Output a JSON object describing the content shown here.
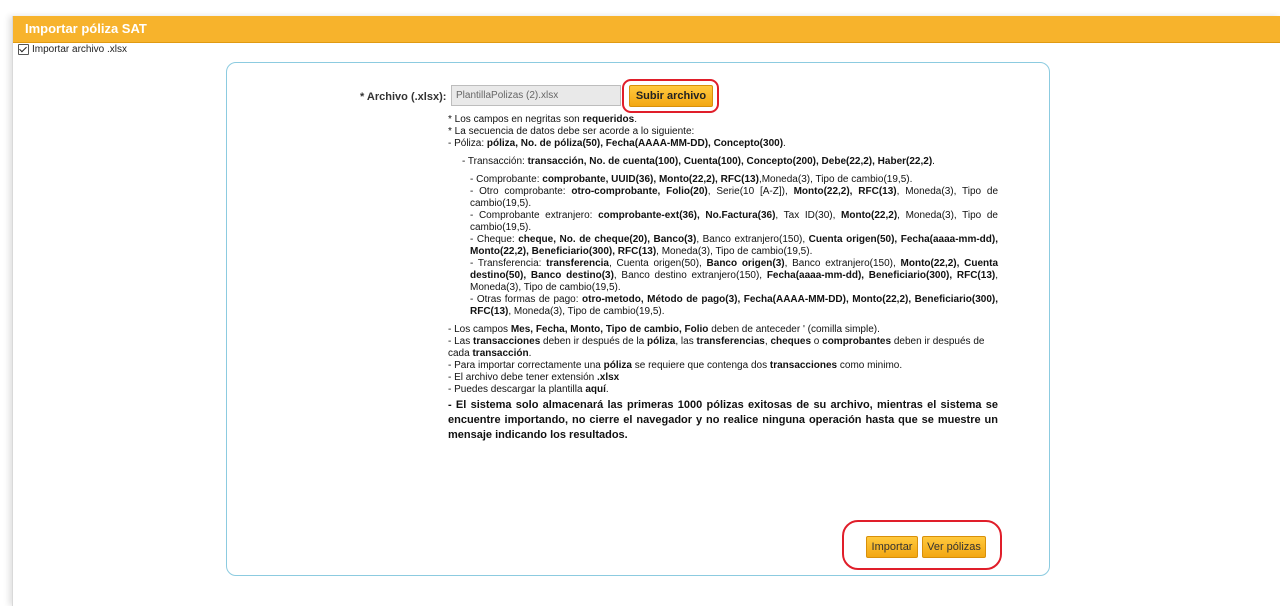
{
  "window": {
    "title": "Importar póliza SAT"
  },
  "import_toggle": {
    "label": "Importar archivo .xlsx",
    "checked": true
  },
  "file_field": {
    "label": "* Archivo (.xlsx):",
    "value": "PlantillaPolizas (2).xlsx",
    "upload_button": "Subir archivo"
  },
  "instructions": {
    "required_note_pre": "* Los campos en negritas son ",
    "required_note_bold": "requeridos",
    "required_note_post": ".",
    "sequence_note": "* La secuencia de datos debe ser acorde a lo siguiente:",
    "poliza_pre": "- Póliza: ",
    "poliza_fields": "póliza, No. de póliza(50), Fecha(AAAA-MM-DD), Concepto(300)",
    "poliza_post": ".",
    "transaccion_pre": "- Transacción: ",
    "transaccion_fields": "transacción, No. de cuenta(100), Cuenta(100), Concepto(200), Debe(22,2), Haber(22,2)",
    "transaccion_post": ".",
    "comprobante_pre": "- Comprobante: ",
    "comprobante_fields": "comprobante, UUID(36), Monto(22,2), RFC(13)",
    "comprobante_post": ",Moneda(3), Tipo de cambio(19,5).",
    "otro_pre": "- Otro comprobante: ",
    "otro_b1": "otro-comprobante, Folio(20)",
    "otro_m1": ", Serie(10 [A-Z]), ",
    "otro_b2": "Monto(22,2), RFC(13)",
    "otro_post": ", Moneda(3), Tipo de cambio(19,5).",
    "ext_pre": "- Comprobante extranjero: ",
    "ext_b1": "comprobante-ext(36), No.Factura(36)",
    "ext_m1": ", Tax ID(30), ",
    "ext_b2": "Monto(22,2)",
    "ext_post": ", Moneda(3), Tipo de cambio(19,5).",
    "cheque_pre": "- Cheque: ",
    "cheque_b1": "cheque, No. de cheque(20), Banco(3)",
    "cheque_m1": ", Banco extranjero(150), ",
    "cheque_b2": "Cuenta origen(50), Fecha(aaaa-mm-dd), Monto(22,2), Beneficiario(300), RFC(13)",
    "cheque_post": ", Moneda(3), Tipo de cambio(19,5).",
    "transf_pre": "- Transferencia: ",
    "transf_b1": "transferencia",
    "transf_m1": ", Cuenta origen(50), ",
    "transf_b2": "Banco origen(3)",
    "transf_m2": ", Banco extranjero(150), ",
    "transf_b3": "Monto(22,2), Cuenta destino(50), Banco destino(3)",
    "transf_m3": ", Banco destino extranjero(150), ",
    "transf_b4": "Fecha(aaaa-mm-dd), Beneficiario(300), RFC(13)",
    "transf_post": ", Moneda(3), Tipo de cambio(19,5).",
    "otros_pre": "- Otras formas de pago: ",
    "otros_fields": "otro-metodo, Método de pago(3), Fecha(AAAA-MM-DD), Monto(22,2), Beneficiario(300), RFC(13)",
    "otros_post": ", Moneda(3), Tipo de cambio(19,5).",
    "campos_pre": "- Los campos ",
    "campos_fields": "Mes, Fecha, Monto, Tipo de cambio, Folio",
    "campos_post": " deben de anteceder ' (comilla simple).",
    "orden_1": "- Las ",
    "orden_b1": "transacciones",
    "orden_2": " deben ir después de la ",
    "orden_b2": "póliza",
    "orden_3": ", las ",
    "orden_b3": "transferencias",
    "orden_4": ", ",
    "orden_b4": "cheques",
    "orden_5": " o ",
    "orden_b5": "comprobantes",
    "orden_6": " deben ir después de cada ",
    "orden_b6": "transacción",
    "orden_7": ".",
    "minimo_1": "- Para importar correctamente una ",
    "minimo_b1": "póliza",
    "minimo_2": " se requiere que contenga dos ",
    "minimo_b2": "transacciones",
    "minimo_3": " como minimo.",
    "ext_note_pre": "- El archivo debe tener extensión ",
    "ext_note_bold": ".xlsx",
    "tpl_pre": "- Puedes descargar la plantilla ",
    "tpl_link": "aquí",
    "tpl_post": ".",
    "warning": "- El sistema solo almacenará las primeras 1000 pólizas exitosas de su archivo, mientras el sistema se encuentre importando, no cierre el navegador y no realice ninguna operación hasta que se muestre un mensaje indicando los resultados."
  },
  "actions": {
    "import_button": "Importar",
    "view_button": "Ver pólizas"
  },
  "colors": {
    "header": "#f7b32c",
    "button": "#f3a712",
    "panel_border": "#8ccbe0",
    "highlight": "#e01e2a"
  }
}
